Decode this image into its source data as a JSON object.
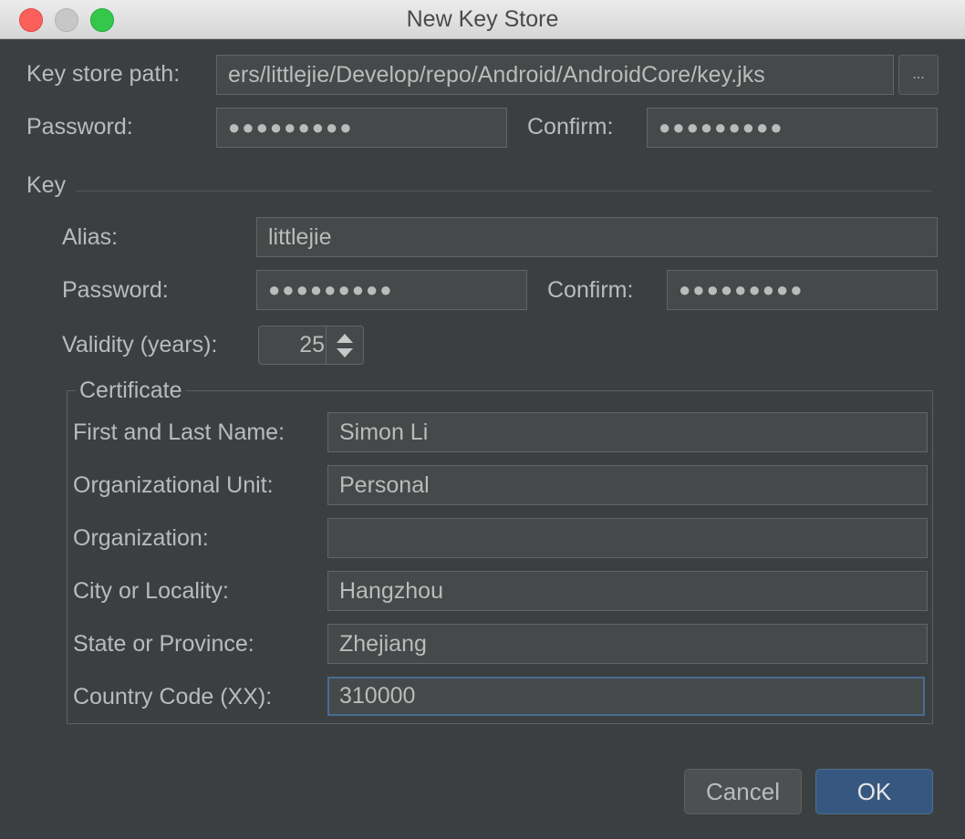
{
  "window": {
    "title": "New Key Store"
  },
  "keystore": {
    "path_label": "Key store path:",
    "path_value": "ers/littlejie/Develop/repo/Android/AndroidCore/key.jks",
    "browse_label": "...",
    "password_label": "Password:",
    "password_value": "●●●●●●●●●",
    "confirm_label": "Confirm:",
    "confirm_value": "●●●●●●●●●"
  },
  "key": {
    "section_label": "Key",
    "alias_label": "Alias:",
    "alias_value": "littlejie",
    "password_label": "Password:",
    "password_value": "●●●●●●●●●",
    "confirm_label": "Confirm:",
    "confirm_value": "●●●●●●●●●",
    "validity_label": "Validity (years):",
    "validity_value": "25"
  },
  "certificate": {
    "title": "Certificate",
    "fields": [
      {
        "label": "First and Last Name:",
        "value": "Simon Li"
      },
      {
        "label": "Organizational Unit:",
        "value": "Personal"
      },
      {
        "label": "Organization:",
        "value": ""
      },
      {
        "label": "City or Locality:",
        "value": "Hangzhou"
      },
      {
        "label": "State or Province:",
        "value": "Zhejiang"
      },
      {
        "label": "Country Code (XX):",
        "value": "310000"
      }
    ]
  },
  "buttons": {
    "cancel": "Cancel",
    "ok": "OK"
  },
  "colors": {
    "background": "#3c3f41",
    "field": "#45494a",
    "focus": "#466d94",
    "primary_button": "#365880"
  }
}
